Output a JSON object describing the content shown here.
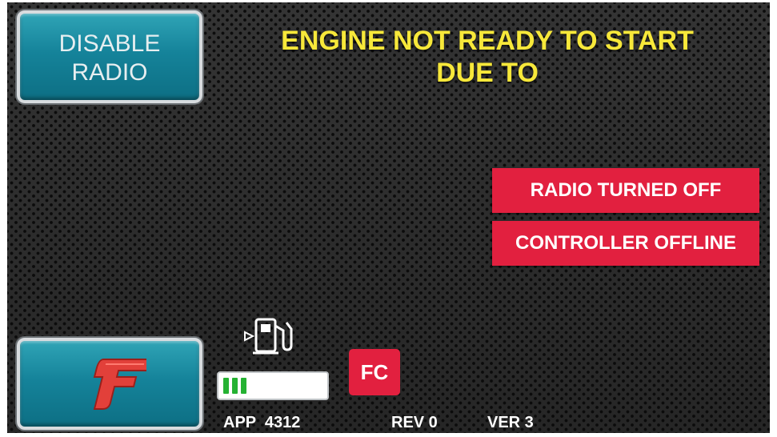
{
  "buttons": {
    "disable_radio": {
      "line1": "DISABLE",
      "line2": "RADIO"
    },
    "brand": {
      "icon": "brand-logo-f-icon"
    }
  },
  "headline": {
    "line1": "ENGINE NOT READY TO START",
    "line2": "DUE TO"
  },
  "alerts": [
    {
      "label": "RADIO TURNED OFF"
    },
    {
      "label": "CONTROLLER OFFLINE"
    }
  ],
  "fuel": {
    "icon": "fuel-pump-icon",
    "level_fraction": 0.25
  },
  "fc_badge": {
    "label": "FC"
  },
  "footer": {
    "app": "APP  4312",
    "rev": "REV 0",
    "ver": "VER 3"
  },
  "colors": {
    "headline": "#f7e83a",
    "alert_bg": "#e2203f",
    "button_teal": "#15839a",
    "fuel_fill": "#25b233"
  }
}
